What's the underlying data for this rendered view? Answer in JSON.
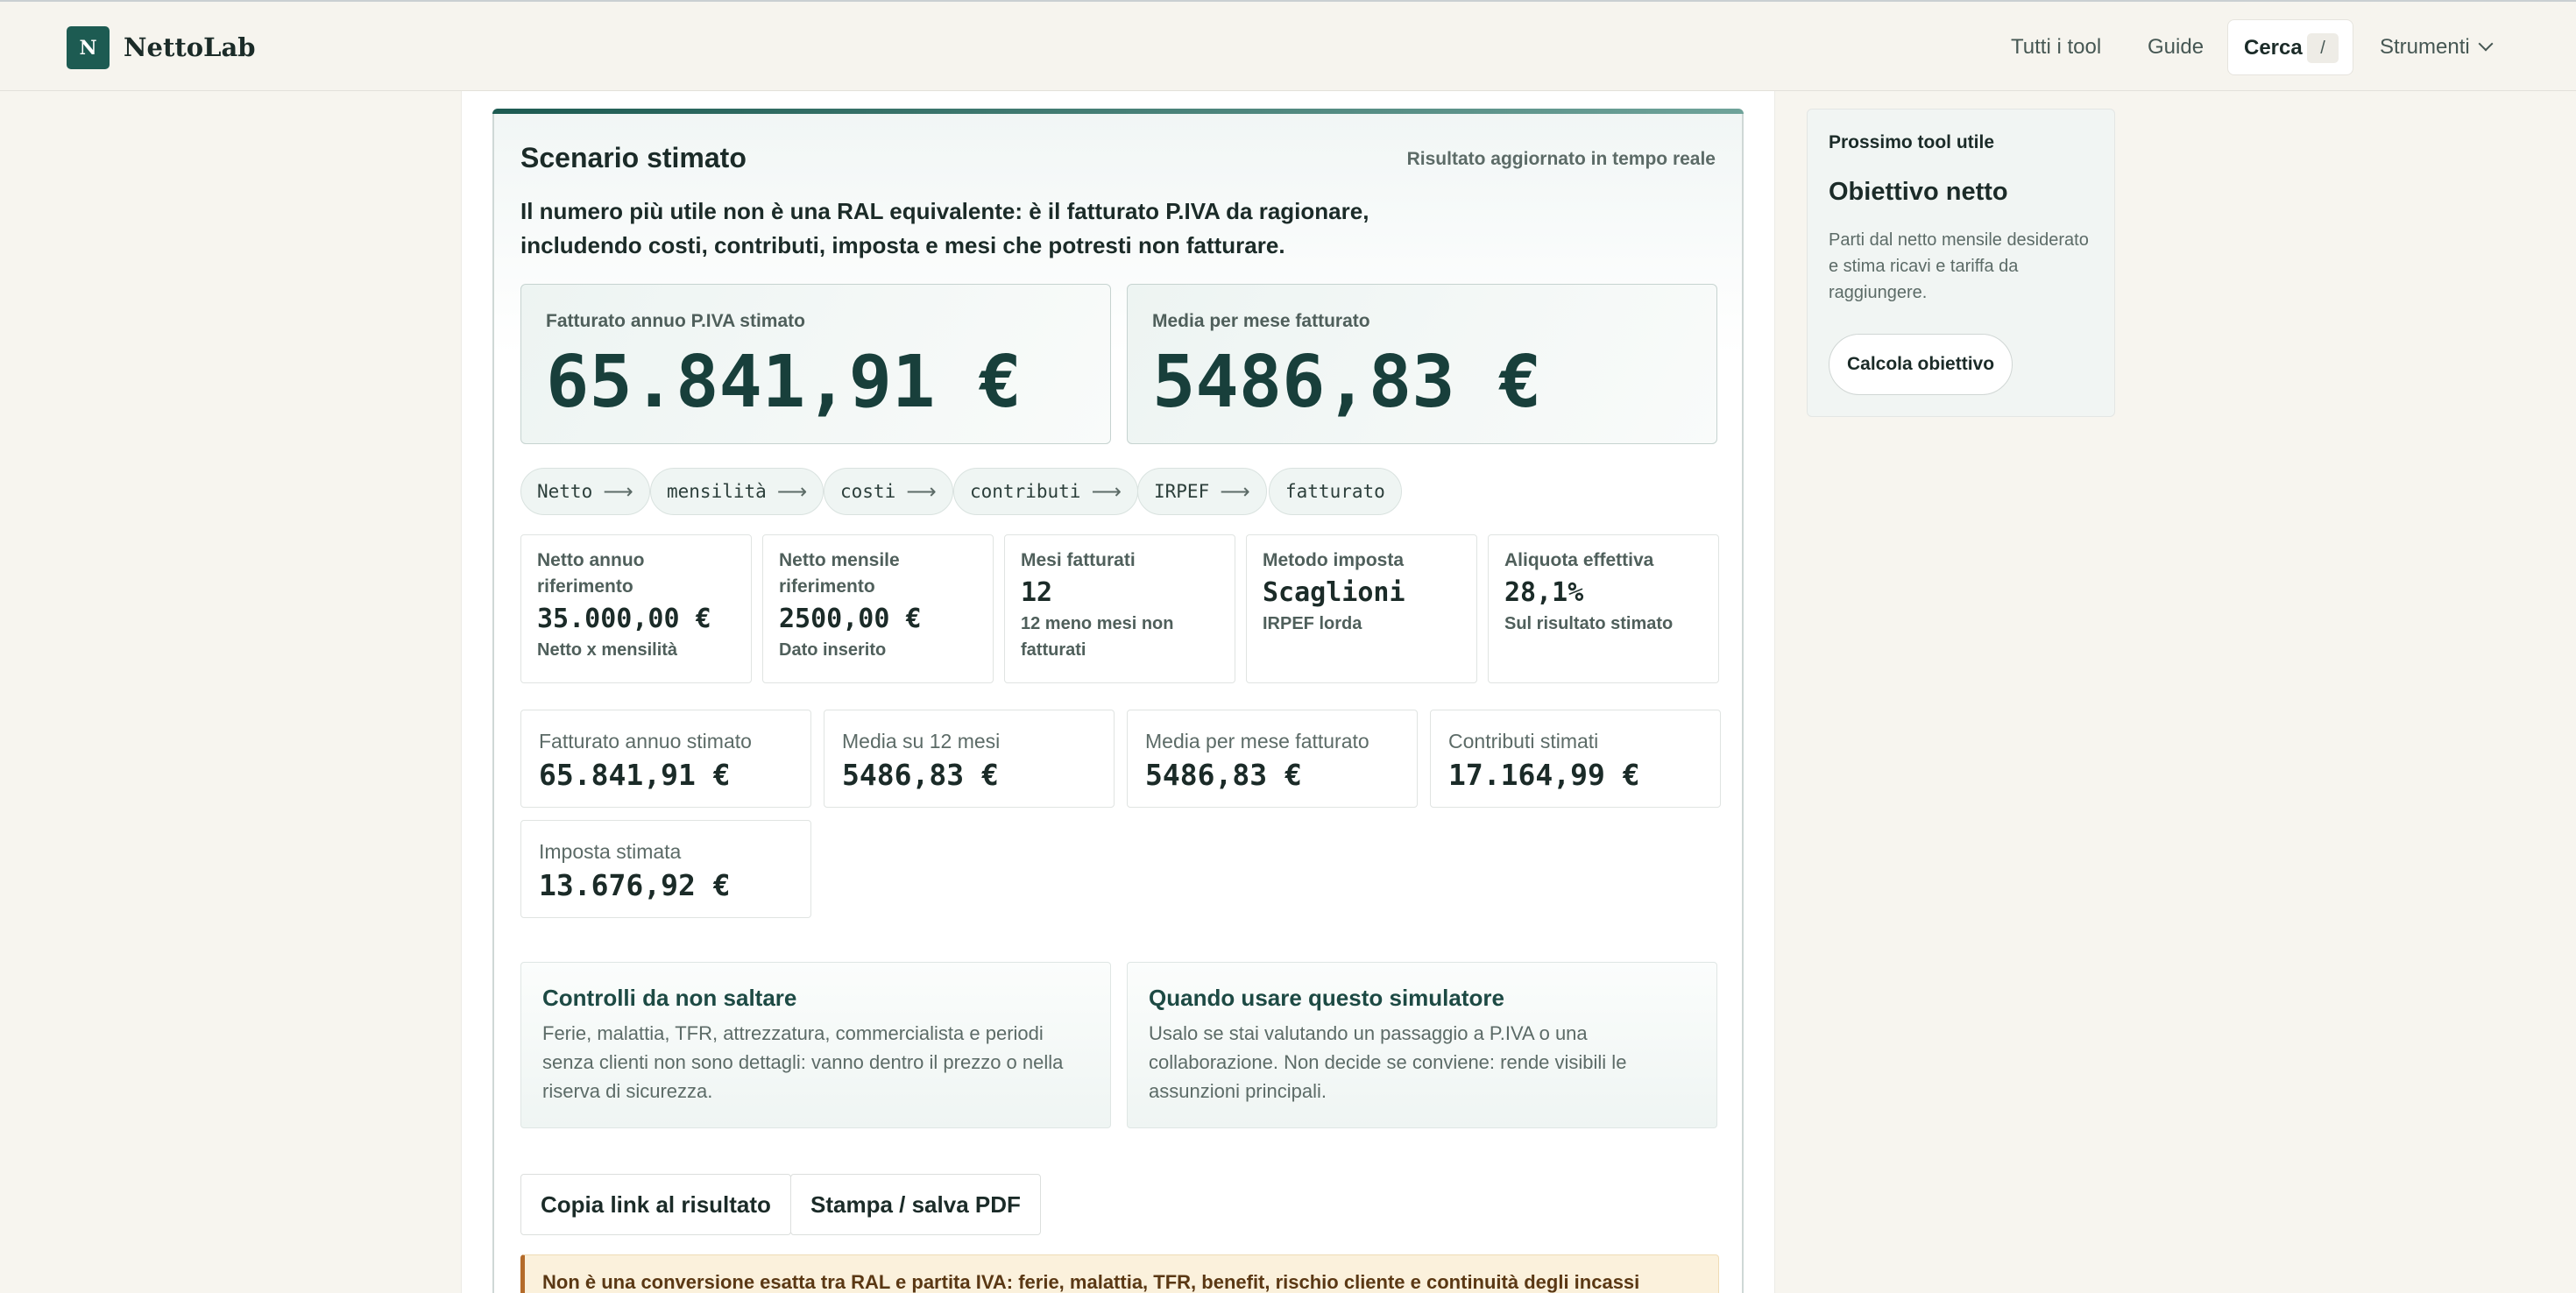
{
  "header": {
    "logo_letter": "N",
    "brand": "NettoLab",
    "nav": [
      "Tutti i tool",
      "Guide"
    ],
    "search_label": "Cerca",
    "search_shortcut": "/",
    "tools_label": "Strumenti"
  },
  "result": {
    "title": "Scenario stimato",
    "status": "Risultato aggiornato in tempo reale",
    "lead": "Il numero più utile non è una RAL equivalente: è il fatturato P.IVA da ragionare, includendo costi, contributi, imposta e mesi che potresti non fatturare.",
    "hero": [
      {
        "label": "Fatturato annuo P.IVA stimato",
        "value": "65.841,91 €"
      },
      {
        "label": "Media per mese fatturato",
        "value": "5486,83 €"
      }
    ],
    "flow": [
      "Netto",
      "mensilità",
      "costi",
      "contributi",
      "IRPEF",
      "fatturato"
    ],
    "flow_arrow": "⟶",
    "metrics": [
      {
        "label": "Netto annuo riferimento",
        "value": "35.000,00 €",
        "note": "Netto x mensilità"
      },
      {
        "label": "Netto mensile riferimento",
        "value": "2500,00 €",
        "note": "Dato inserito"
      },
      {
        "label": "Mesi fatturati",
        "value": "12",
        "note": "12 meno mesi non fatturati"
      },
      {
        "label": "Metodo imposta",
        "value": "Scaglioni",
        "note": "IRPEF lorda"
      },
      {
        "label": "Aliquota effettiva",
        "value": "28,1%",
        "note": "Sul risultato stimato"
      }
    ],
    "summary": [
      {
        "label": "Fatturato annuo stimato",
        "value": "65.841,91 €"
      },
      {
        "label": "Media su 12 mesi",
        "value": "5486,83 €"
      },
      {
        "label": "Media per mese fatturato",
        "value": "5486,83 €"
      },
      {
        "label": "Contributi stimati",
        "value": "17.164,99 €"
      },
      {
        "label": "Imposta stimata",
        "value": "13.676,92 €"
      }
    ],
    "info": [
      {
        "title": "Controlli da non saltare",
        "text": "Ferie, malattia, TFR, attrezzatura, commercialista e periodi senza clienti non sono dettagli: vanno dentro il prezzo o nella riserva di sicurezza."
      },
      {
        "title": "Quando usare questo simulatore",
        "text": "Usalo se stai valutando un passaggio a P.IVA o una collaborazione. Non decide se conviene: rende visibili le assunzioni principali."
      }
    ],
    "actions": {
      "copy": "Copia link al risultato",
      "print": "Stampa / salva PDF"
    },
    "warning": "Non è una conversione esatta tra RAL e partita IVA: ferie, malattia, TFR, benefit, rischio cliente e continuità degli incassi"
  },
  "sidebar": {
    "kicker": "Prossimo tool utile",
    "title": "Obiettivo netto",
    "text": "Parti dal netto mensile desiderato e stima ricavi e tariffa da raggiungere.",
    "button": "Calcola obiettivo"
  }
}
